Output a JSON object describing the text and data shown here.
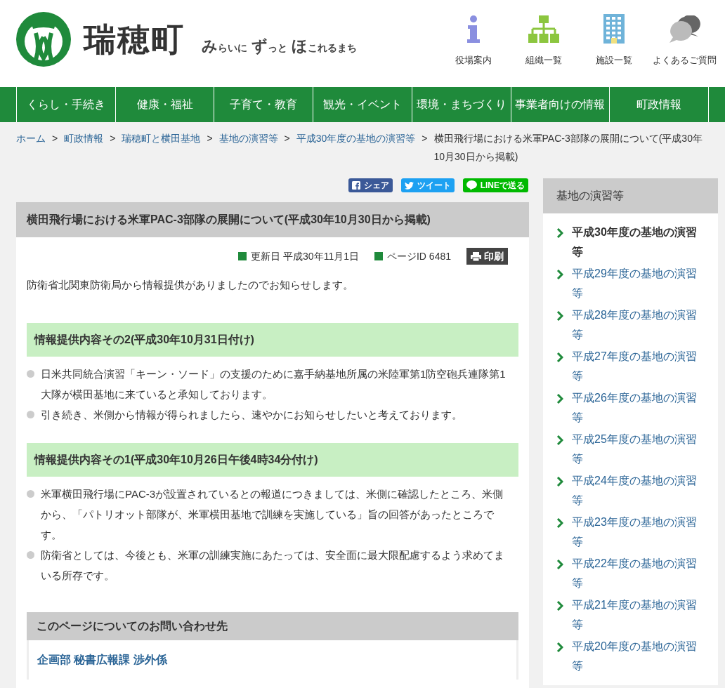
{
  "header": {
    "site_name": "瑞穂町",
    "tagline": [
      {
        "text": "み",
        "emphasis": true
      },
      {
        "text": "らいに",
        "emphasis": false
      },
      {
        "text": "ず",
        "emphasis": true
      },
      {
        "text": "っと",
        "emphasis": false
      },
      {
        "text": "ほ",
        "emphasis": true
      },
      {
        "text": "これるまち",
        "emphasis": false
      }
    ],
    "quick_links": [
      {
        "kind": "info",
        "label": "役場案内"
      },
      {
        "kind": "org",
        "label": "組織一覧"
      },
      {
        "kind": "building",
        "label": "施設一覧"
      },
      {
        "kind": "faq",
        "label": "よくあるご質問"
      }
    ]
  },
  "nav": [
    "くらし・手続き",
    "健康・福祉",
    "子育て・教育",
    "観光・イベント",
    "環境・まちづくり",
    "事業者向けの情報",
    "町政情報"
  ],
  "breadcrumb": {
    "separator": ">",
    "links": [
      "ホーム",
      "町政情報",
      "瑞穂町と横田基地",
      "基地の演習等",
      "平成30年度の基地の演習等"
    ],
    "current": "横田飛行場における米軍PAC-3部隊の展開について(平成30年10月30日から掲載)"
  },
  "share": [
    {
      "kind": "facebook",
      "label": "シェア"
    },
    {
      "kind": "twitter",
      "label": "ツイート"
    },
    {
      "kind": "line",
      "label": "LINEで送る"
    }
  ],
  "article": {
    "title": "横田飛行場における米軍PAC-3部隊の展開について(平成30年10月30日から掲載)",
    "updated": "更新日 平成30年11月1日",
    "page_id": "ページID 6481",
    "print": "印刷",
    "intro": "防衛省北関東防衛局から情報提供がありましたのでお知らせします。",
    "sections": [
      {
        "heading": "情報提供内容その2(平成30年10月31日付け)",
        "bullets": [
          "日米共同統合演習「キーン・ソード」の支援のために嘉手納基地所属の米陸軍第1防空砲兵連隊第1大隊が横田基地に来ていると承知しております。",
          "引き続き、米側から情報が得られましたら、速やかにお知らせしたいと考えております。"
        ]
      },
      {
        "heading": "情報提供内容その1(平成30年10月26日午後4時34分付け)",
        "bullets": [
          "米軍横田飛行場にPAC-3が設置されているとの報道につきましては、米側に確認したところ、米側から、「パトリオット部隊が、米軍横田基地で訓練を実施している」旨の回答があったところです。",
          "防衛省としては、今後とも、米軍の訓練実施にあたっては、安全面に最大限配慮するよう求めてまいる所存です。"
        ]
      }
    ],
    "contact": {
      "heading": "このページについてのお問い合わせ先",
      "department": "企画部 秘書広報課 渉外係"
    }
  },
  "sidebar": {
    "title": "基地の演習等",
    "items": [
      {
        "label": "平成30年度の基地の演習等",
        "selected": true
      },
      {
        "label": "平成29年度の基地の演習等",
        "selected": false
      },
      {
        "label": "平成28年度の基地の演習等",
        "selected": false
      },
      {
        "label": "平成27年度の基地の演習等",
        "selected": false
      },
      {
        "label": "平成26年度の基地の演習等",
        "selected": false
      },
      {
        "label": "平成25年度の基地の演習等",
        "selected": false
      },
      {
        "label": "平成24年度の基地の演習等",
        "selected": false
      },
      {
        "label": "平成23年度の基地の演習等",
        "selected": false
      },
      {
        "label": "平成22年度の基地の演習等",
        "selected": false
      },
      {
        "label": "平成21年度の基地の演習等",
        "selected": false
      },
      {
        "label": "平成20年度の基地の演習等",
        "selected": false
      }
    ]
  }
}
